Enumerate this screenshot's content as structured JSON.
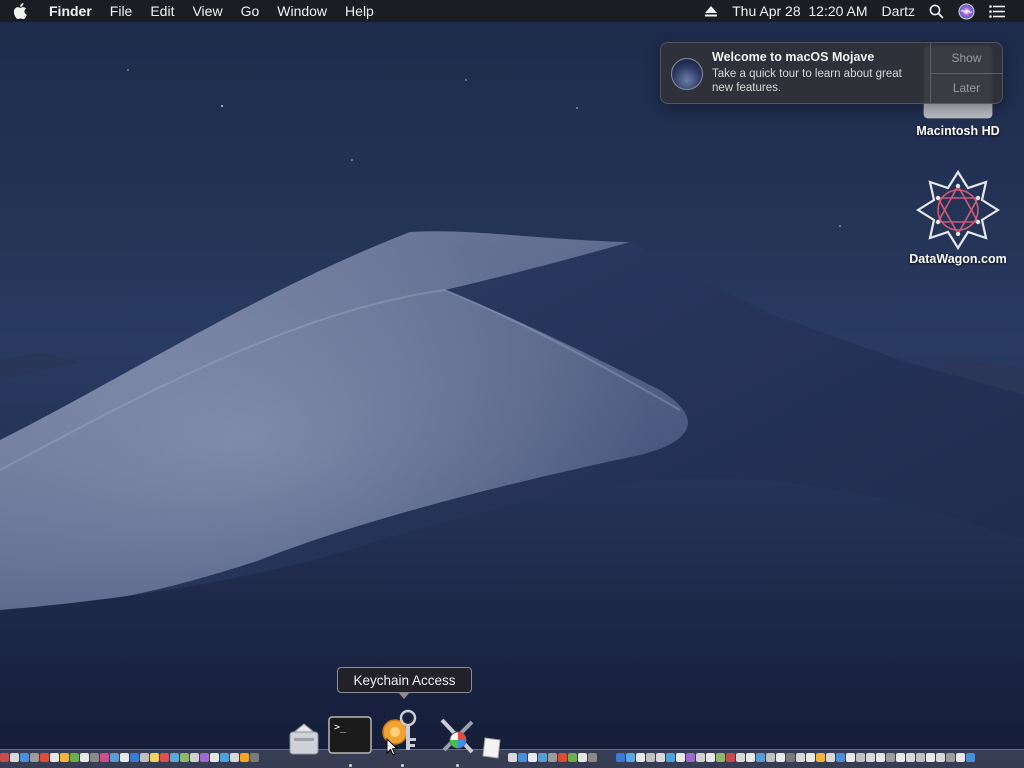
{
  "menubar": {
    "app_name": "Finder",
    "menus": [
      "File",
      "Edit",
      "View",
      "Go",
      "Window",
      "Help"
    ],
    "date_time": "Thu Apr 28  12:20 AM",
    "user": "Dartz",
    "icons": [
      "apple-icon",
      "eject-icon",
      "search-icon",
      "siri-icon",
      "notification-center-icon"
    ]
  },
  "notification": {
    "title": "Welcome to macOS Mojave",
    "text": "Take a quick tour to learn about great new features.",
    "show_label": "Show",
    "later_label": "Later"
  },
  "desktop_icons": [
    {
      "label": "Macintosh HD",
      "icon": "hard-drive-icon"
    },
    {
      "label": "DataWagon.com",
      "icon": "datawagon-logo-icon"
    }
  ],
  "dock": {
    "tooltip": "Keychain Access",
    "big_items": [
      "Migration Assistant",
      "Terminal",
      "Keychain Access",
      "System Information",
      "TextEdit"
    ]
  },
  "colors": {
    "menubar_bg": "#1c1c20",
    "tooltip_bg": "#222226",
    "notification_bg": "#303238"
  }
}
